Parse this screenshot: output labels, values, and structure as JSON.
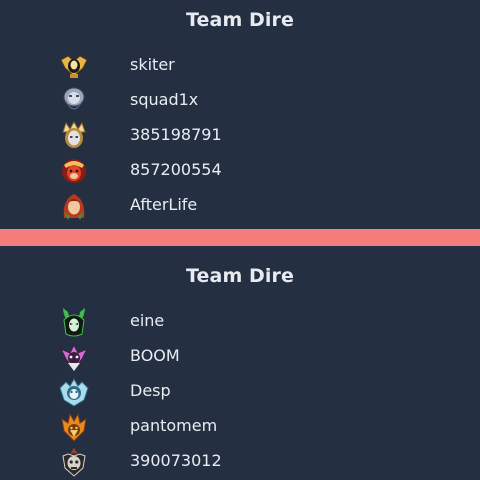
{
  "teams": [
    {
      "title": "Team Dire",
      "players": [
        {
          "name": "skiter",
          "icon": "hero-gold-winged-icon",
          "colors": [
            "#1a1a1a",
            "#e9b54a",
            "#f7e2a0"
          ]
        },
        {
          "name": "squad1x",
          "icon": "hero-bearded-elder-icon",
          "colors": [
            "#6b7d9a",
            "#d9dee6",
            "#9aa7bc"
          ]
        },
        {
          "name": "385198791",
          "icon": "hero-gold-crown-icon",
          "colors": [
            "#b88a3c",
            "#f2d79b",
            "#e2e2e2"
          ]
        },
        {
          "name": "857200554",
          "icon": "hero-red-monkey-icon",
          "colors": [
            "#8a1c14",
            "#e0462a",
            "#f0c35a"
          ]
        },
        {
          "name": "AfterLife",
          "icon": "hero-windranger-icon",
          "colors": [
            "#b83a1c",
            "#4c8a3a",
            "#f0c9a0"
          ]
        }
      ]
    },
    {
      "title": "Team Dire",
      "players": [
        {
          "name": "eine",
          "icon": "hero-green-horned-icon",
          "colors": [
            "#0e1a12",
            "#3fbf4a",
            "#d8f0d8"
          ]
        },
        {
          "name": "BOOM",
          "icon": "hero-purple-mask-icon",
          "colors": [
            "#3a2040",
            "#d46ad0",
            "#e8e8e8"
          ]
        },
        {
          "name": "Desp",
          "icon": "hero-ice-beast-icon",
          "colors": [
            "#2e6c8a",
            "#a9dcec",
            "#e8f6fb"
          ]
        },
        {
          "name": "pantomem",
          "icon": "hero-fire-bird-icon",
          "colors": [
            "#7a3a10",
            "#e88a1e",
            "#f5cf6a"
          ]
        },
        {
          "name": "390073012",
          "icon": "hero-skull-warrior-icon",
          "colors": [
            "#2a2a2a",
            "#d9d3c7",
            "#a33a2a"
          ]
        }
      ]
    }
  ]
}
